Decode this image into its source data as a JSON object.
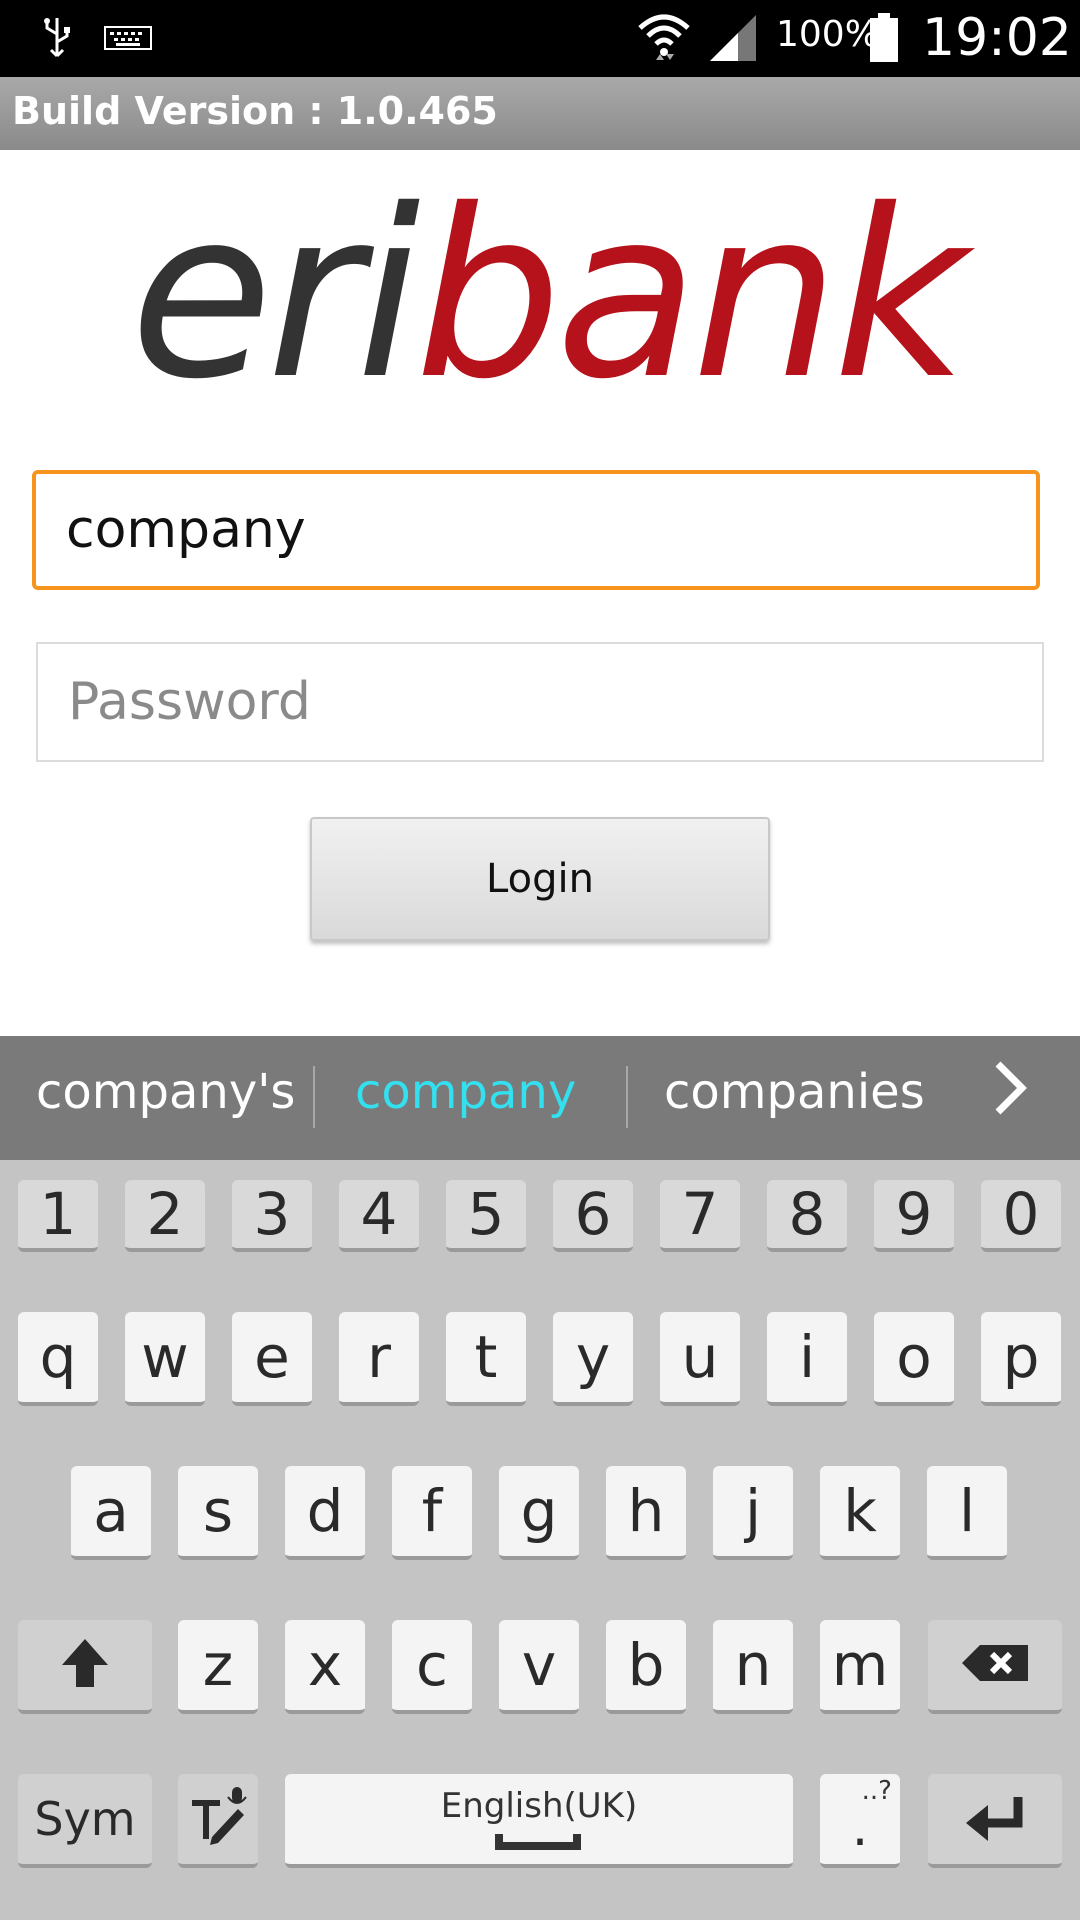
{
  "status_bar": {
    "battery_text": "100%",
    "clock": "19:02",
    "icons": [
      "usb-icon",
      "keyboard-icon",
      "wifi-icon",
      "signal-icon",
      "battery-icon"
    ]
  },
  "action_bar": {
    "title": "Build Version : 1.0.465"
  },
  "logo": {
    "part1": "eri",
    "part2": "bank",
    "colors": {
      "part1": "#333333",
      "part2": "#b5121b"
    }
  },
  "form": {
    "username_value": "company",
    "password_placeholder": "Password",
    "login_label": "Login"
  },
  "suggestions": {
    "items": [
      "company's",
      "company",
      "companies"
    ],
    "highlight_color": "#33e0f0"
  },
  "keyboard": {
    "numbers": [
      "1",
      "2",
      "3",
      "4",
      "5",
      "6",
      "7",
      "8",
      "9",
      "0"
    ],
    "row1": [
      "q",
      "w",
      "e",
      "r",
      "t",
      "y",
      "u",
      "i",
      "o",
      "p"
    ],
    "row2": [
      "a",
      "s",
      "d",
      "f",
      "g",
      "h",
      "j",
      "k",
      "l"
    ],
    "row3": [
      "z",
      "x",
      "c",
      "v",
      "b",
      "n",
      "m"
    ],
    "sym_label": "Sym",
    "space_label": "English(UK)",
    "period_label": ".",
    "period_hint": "..?"
  }
}
